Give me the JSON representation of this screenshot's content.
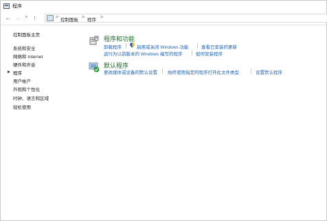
{
  "window": {
    "title": "程序"
  },
  "nav": {
    "back_icon": "back-arrow-icon",
    "forward_icon": "forward-arrow-icon",
    "recent_icon": "chevron-down-icon",
    "up_icon": "up-arrow-icon"
  },
  "address": {
    "crumbs": [
      "控制面板",
      "程序"
    ],
    "separator": ">"
  },
  "sidebar": {
    "items": [
      "控制面板主页",
      "系统和安全",
      "网络和 Internet",
      "硬件和声音",
      "程序",
      "用户帐户",
      "外观和个性化",
      "时钟、语言和区域",
      "轻松使用"
    ],
    "current_index": 4
  },
  "sections": [
    {
      "title": "程序和功能",
      "icon": "programs-features-icon",
      "links_row1": [
        "卸载程序",
        "启用或关闭 Windows 功能",
        "查看已安装的更新"
      ],
      "links_row2": [
        "运行为以前版本的 Windows 编写的程序",
        "如何安装程序"
      ]
    },
    {
      "title": "默认程序",
      "icon": "default-programs-icon",
      "links_row1": [
        "更改媒体或设备的默认设置",
        "始终使用指定的程序打开此文件类型",
        "设置默认程序"
      ]
    }
  ],
  "colors": {
    "section_title": "#1d6a2b",
    "link": "#1a5fb4",
    "shield": "#2b5fb3"
  }
}
